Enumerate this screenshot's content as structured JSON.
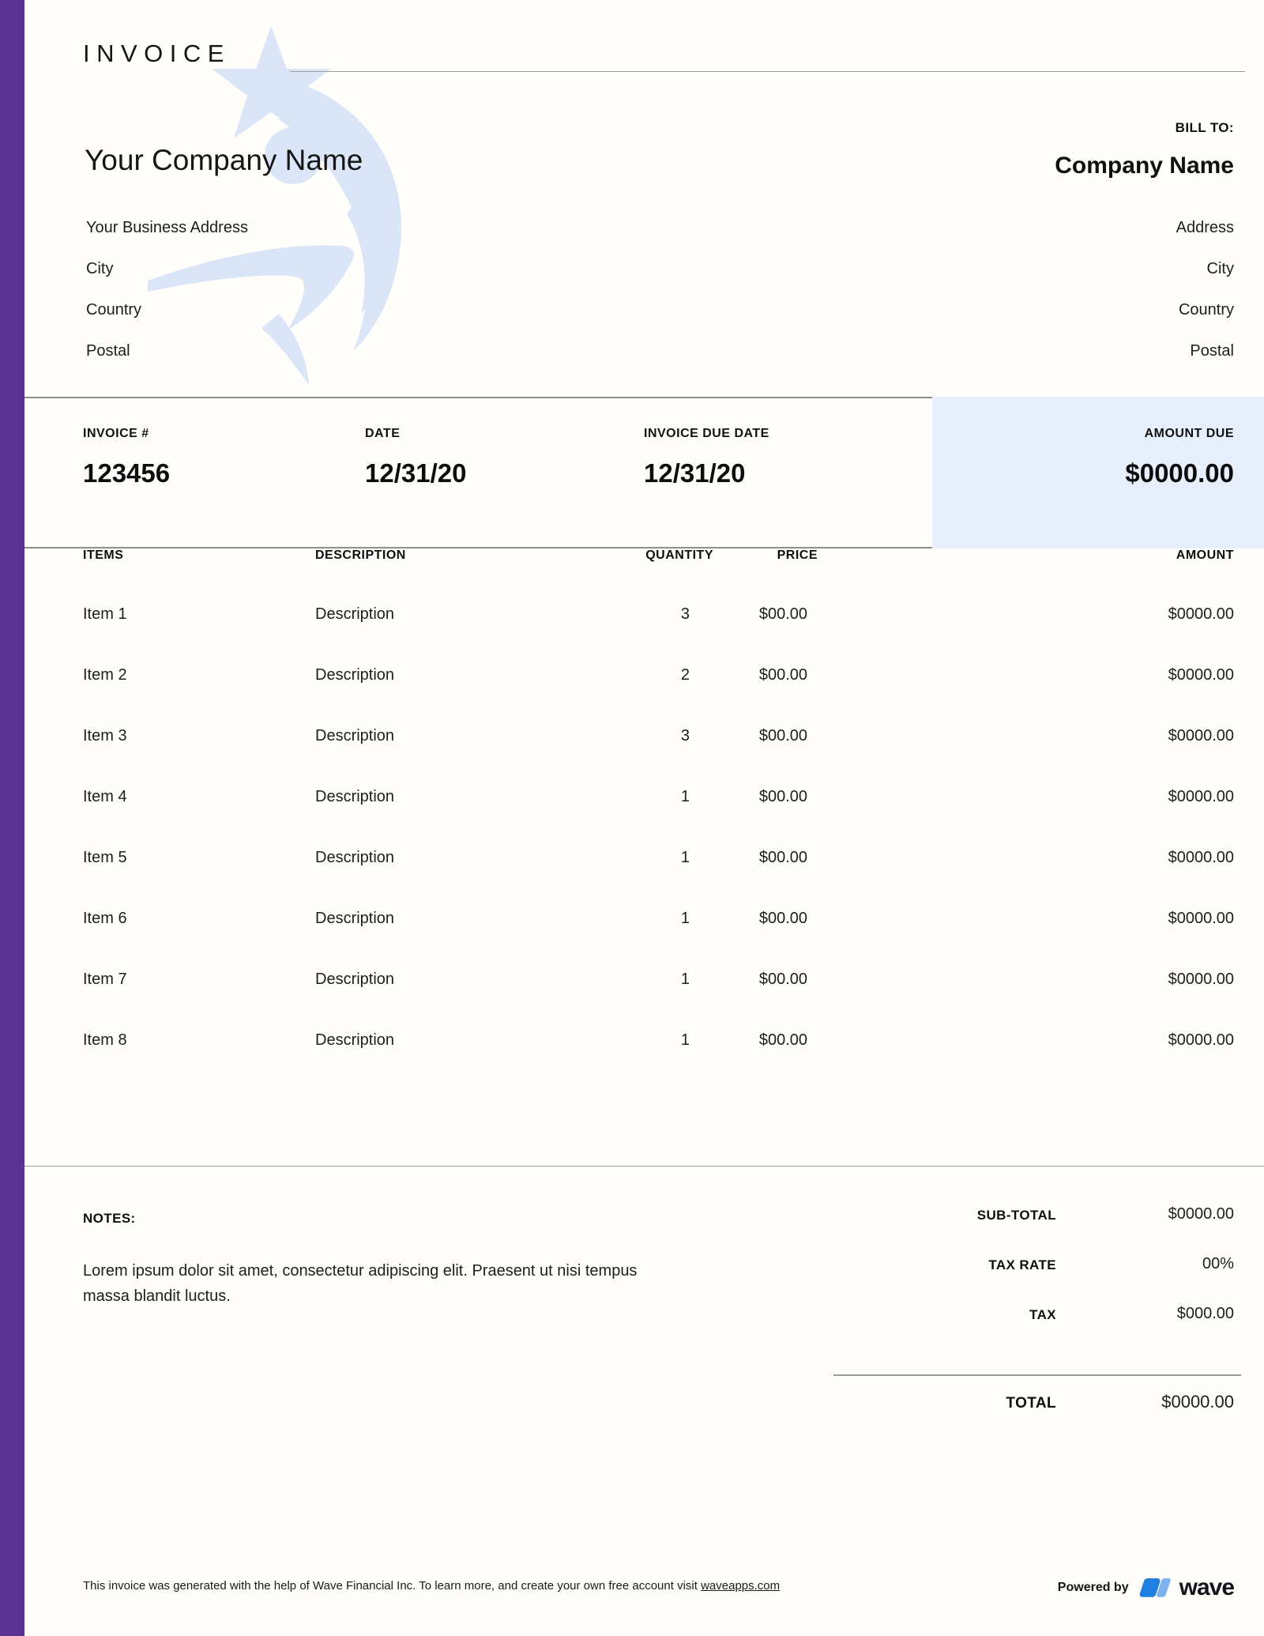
{
  "document": {
    "title": "INVOICE"
  },
  "colors": {
    "sidebar_purple": "#5A3293",
    "amount_due_panel": "#E8EFFC",
    "watermark_blue": "#D9E4F8",
    "wave_logo_blue_dark": "#1E7FE0",
    "wave_logo_blue_light": "#7FB2F0"
  },
  "sender": {
    "company_name": "Your Company Name",
    "address_lines": [
      "Your Business Address",
      "City",
      "Country",
      "Postal"
    ]
  },
  "bill_to": {
    "label": "BILL TO:",
    "company_name": "Company Name",
    "address_lines": [
      "Address",
      "City",
      "Country",
      "Postal"
    ]
  },
  "meta": {
    "invoice_number": {
      "label": "INVOICE #",
      "value": "123456"
    },
    "date": {
      "label": "DATE",
      "value": "12/31/20"
    },
    "due_date": {
      "label": "INVOICE DUE DATE",
      "value": "12/31/20"
    },
    "amount_due": {
      "label": "AMOUNT DUE",
      "value": "$0000.00"
    }
  },
  "items_table": {
    "columns": {
      "items": "ITEMS",
      "description": "DESCRIPTION",
      "quantity": "QUANTITY",
      "price": "PRICE",
      "amount": "AMOUNT"
    },
    "rows": [
      {
        "item": "Item 1",
        "description": "Description",
        "quantity": "3",
        "price": "$00.00",
        "amount": "$0000.00"
      },
      {
        "item": "Item 2",
        "description": "Description",
        "quantity": "2",
        "price": "$00.00",
        "amount": "$0000.00"
      },
      {
        "item": "Item 3",
        "description": "Description",
        "quantity": "3",
        "price": "$00.00",
        "amount": "$0000.00"
      },
      {
        "item": "Item 4",
        "description": "Description",
        "quantity": "1",
        "price": "$00.00",
        "amount": "$0000.00"
      },
      {
        "item": "Item 5",
        "description": "Description",
        "quantity": "1",
        "price": "$00.00",
        "amount": "$0000.00"
      },
      {
        "item": "Item 6",
        "description": "Description",
        "quantity": "1",
        "price": "$00.00",
        "amount": "$0000.00"
      },
      {
        "item": "Item 7",
        "description": "Description",
        "quantity": "1",
        "price": "$00.00",
        "amount": "$0000.00"
      },
      {
        "item": "Item 8",
        "description": "Description",
        "quantity": "1",
        "price": "$00.00",
        "amount": "$0000.00"
      }
    ]
  },
  "notes": {
    "label": "NOTES:",
    "body": "Lorem ipsum dolor sit amet, consectetur adipiscing elit. Praesent ut nisi tempus massa blandit luctus."
  },
  "totals": {
    "sub_total": {
      "label": "SUB-TOTAL",
      "value": "$0000.00"
    },
    "tax_rate": {
      "label": "TAX RATE",
      "value": "00%"
    },
    "tax": {
      "label": "TAX",
      "value": "$000.00"
    },
    "total": {
      "label": "TOTAL",
      "value": "$0000.00"
    }
  },
  "footer": {
    "text_before_link": "This invoice was generated with the help of Wave Financial Inc. To learn more, and create your own free account visit ",
    "link_text": "waveapps.com",
    "powered_by_label": "Powered by",
    "brand_name": "wave"
  }
}
